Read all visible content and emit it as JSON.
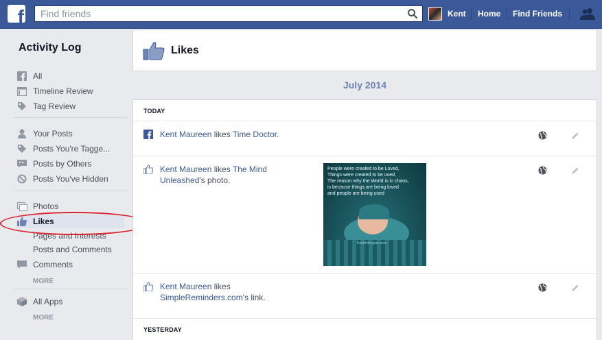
{
  "topbar": {
    "logo": "f",
    "search_placeholder": "Find friends",
    "user_name": "Kent",
    "home_label": "Home",
    "find_friends_label": "Find Friends"
  },
  "sidebar": {
    "title": "Activity Log",
    "group1": [
      {
        "label": "All",
        "icon": "facebook-icon"
      },
      {
        "label": "Timeline Review",
        "icon": "timeline-icon"
      },
      {
        "label": "Tag Review",
        "icon": "tag-icon"
      }
    ],
    "group2": [
      {
        "label": "Your Posts",
        "icon": "person-icon"
      },
      {
        "label": "Posts You're Tagge...",
        "icon": "tag-icon"
      },
      {
        "label": "Posts by Others",
        "icon": "speech-bubble-icon"
      },
      {
        "label": "Posts You've Hidden",
        "icon": "hidden-icon"
      }
    ],
    "group3": [
      {
        "label": "Photos",
        "icon": "photos-icon"
      },
      {
        "label": "Likes",
        "icon": "thumbs-up-icon"
      },
      {
        "label": "Pages and Interests"
      },
      {
        "label": "Posts and Comments"
      },
      {
        "label": "Comments",
        "icon": "comment-icon"
      }
    ],
    "more1": "MORE",
    "group4": [
      {
        "label": "All Apps",
        "icon": "cube-icon"
      }
    ],
    "more2": "MORE"
  },
  "main": {
    "header_title": "Likes",
    "month": "July 2014",
    "sections": [
      {
        "label": "TODAY",
        "rows": [
          {
            "actor": "Kent Maureen",
            "verb": " likes ",
            "object": "Time Doctor",
            "tail": "."
          },
          {
            "actor": "Kent Maureen",
            "verb": " likes ",
            "object": "The Mind Unleashed",
            "tail": "'s photo.",
            "photo_text": [
              "People were created to be Loved,",
              "Things were created to be used.",
              "The reason why the World is in chaos,",
              "is because things are being loved",
              "and people are being used"
            ],
            "photo_credit": "Tumblr4Inspire.com"
          },
          {
            "actor": "Kent Maureen",
            "verb": " likes ",
            "object": "SimpleReminders.com",
            "tail": "'s link."
          }
        ]
      },
      {
        "label": "YESTERDAY"
      }
    ]
  },
  "colors": {
    "brand": "#3b5998",
    "annotation": "#d9232e",
    "month": "#6d84b4"
  }
}
